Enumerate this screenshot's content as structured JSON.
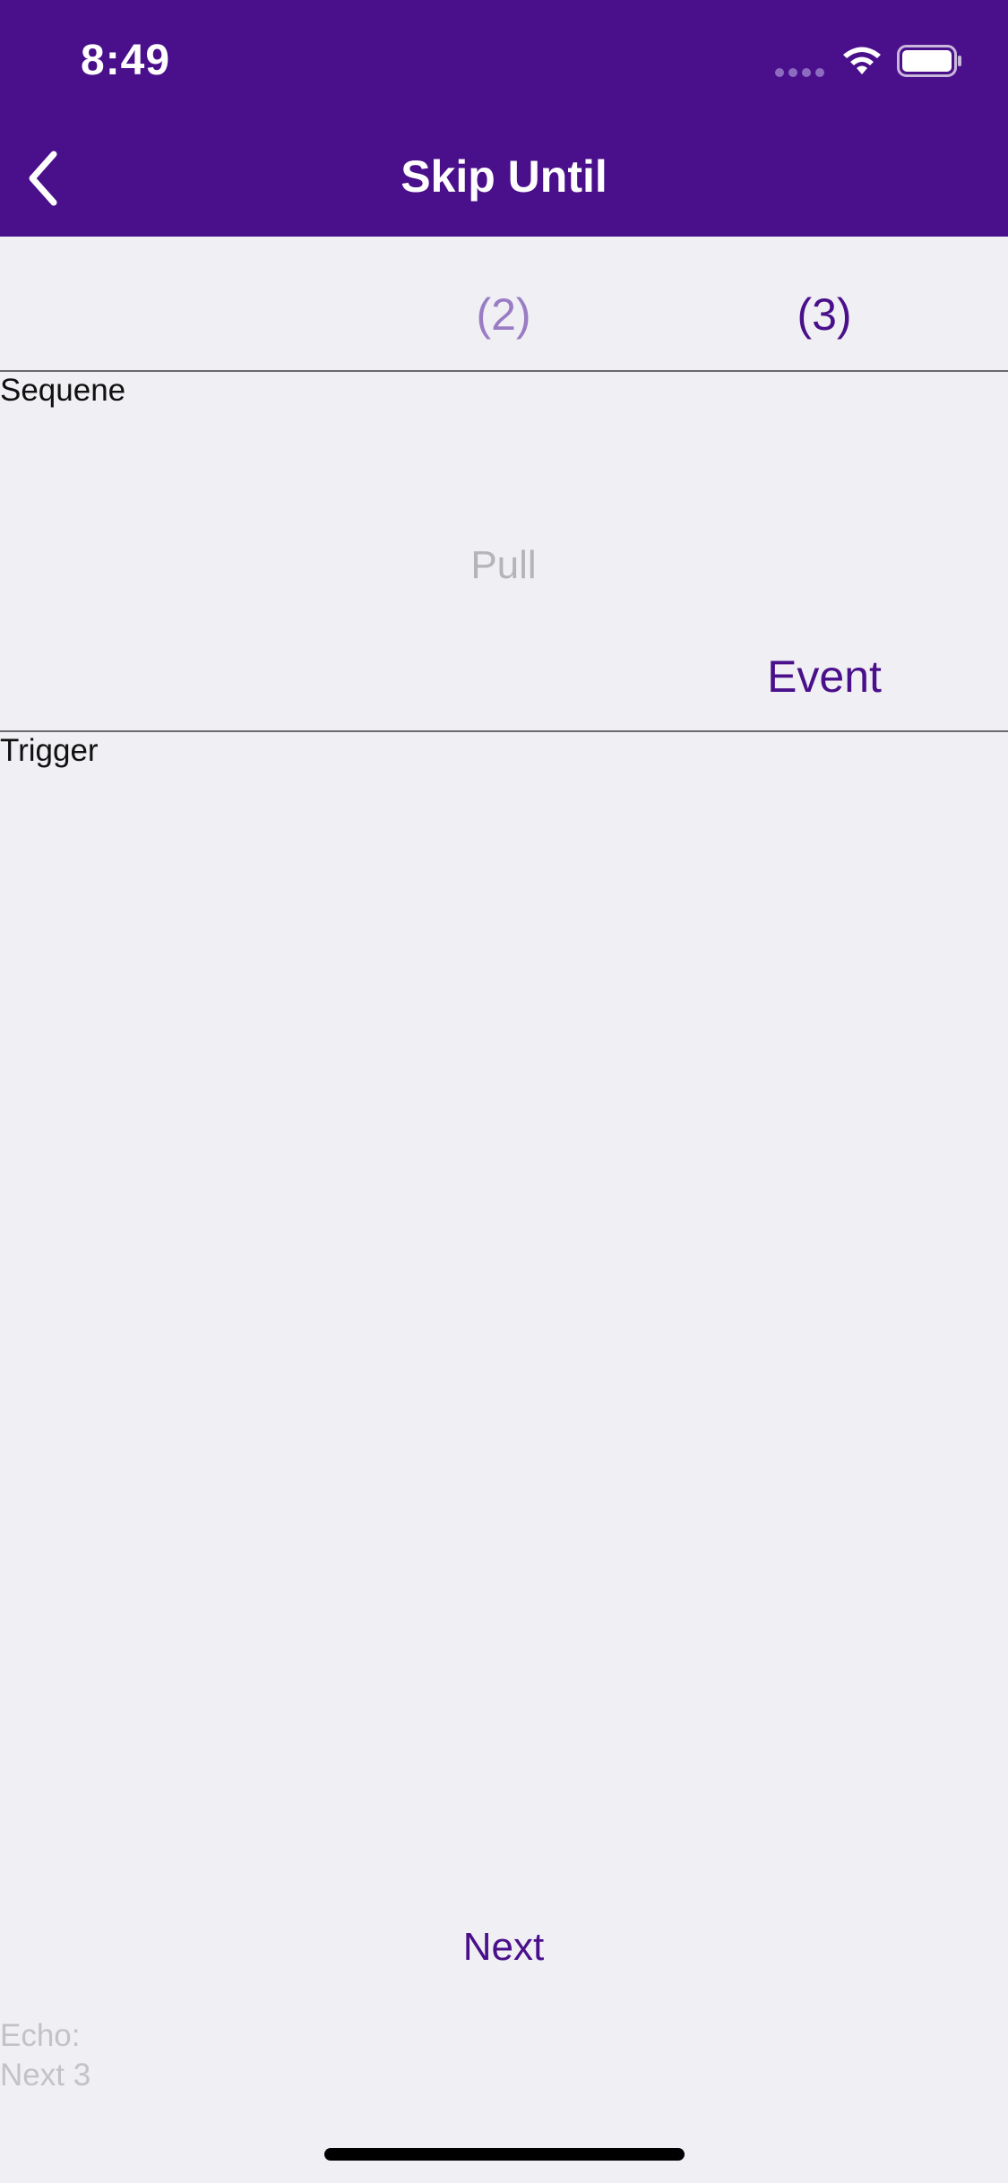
{
  "status_bar": {
    "time": "8:49"
  },
  "nav": {
    "title": "Skip Until",
    "back_icon": "chevron-left-icon"
  },
  "columns": {
    "col2": "(2)",
    "col3": "(3)"
  },
  "rows": {
    "sequence_label": "Sequene",
    "trigger_label": "Trigger"
  },
  "cells": {
    "pull": "Pull",
    "event": "Event"
  },
  "actions": {
    "next_label": "Next"
  },
  "echo": {
    "line1": "Echo:",
    "line2": "Next 3"
  },
  "colors": {
    "header_bg": "#4a0f8a",
    "accent": "#4a0f8a",
    "accent_light": "#9a7cc4",
    "background": "#efeff4",
    "muted_text": "#b5b5b8"
  }
}
